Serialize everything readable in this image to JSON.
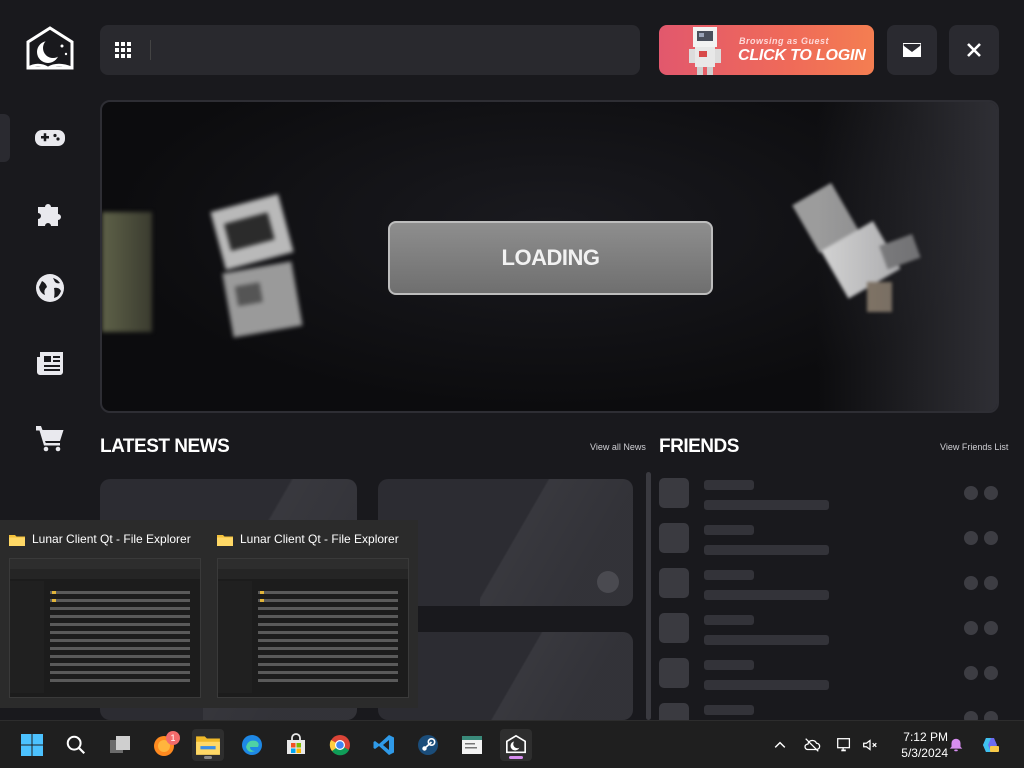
{
  "header": {
    "login_small": "Browsing as Guest",
    "login_big": "CLICK TO LOGIN",
    "search_placeholder": ""
  },
  "sidebar": {
    "items": [
      {
        "name": "play",
        "icon": "gamepad-icon"
      },
      {
        "name": "mods",
        "icon": "puzzle-icon"
      },
      {
        "name": "servers",
        "icon": "globe-icon"
      },
      {
        "name": "news",
        "icon": "newspaper-icon"
      },
      {
        "name": "store",
        "icon": "cart-icon"
      }
    ]
  },
  "hero": {
    "button_label": "LOADING"
  },
  "news": {
    "title": "LATEST NEWS",
    "view_all": "View all News"
  },
  "friends": {
    "title": "FRIENDS",
    "view_all": "View Friends List"
  },
  "thumbnails": [
    {
      "title": "Lunar Client Qt - File Explorer"
    },
    {
      "title": "Lunar Client Qt - File Explorer"
    }
  ],
  "taskbar": {
    "badge_count": "1",
    "time": "7:12 PM",
    "date": "5/3/2024",
    "apps": [
      "start-icon",
      "search-icon",
      "task-view-icon",
      "firefox-icon",
      "file-explorer-icon",
      "edge-icon",
      "store-icon",
      "chrome-icon",
      "vscode-icon",
      "steam-icon",
      "notepad-icon",
      "lunar-client-icon"
    ]
  },
  "colors": {
    "background": "#19191d",
    "login_gradient_start": "#e2586d",
    "login_gradient_end": "#f47e51"
  }
}
